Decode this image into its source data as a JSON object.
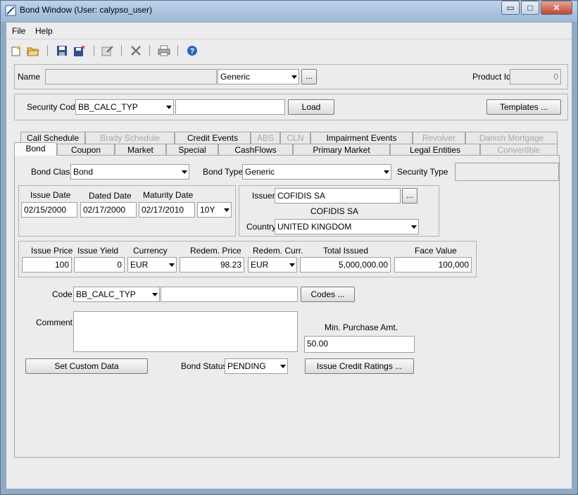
{
  "window": {
    "title": "Bond Window (User: calypso_user)",
    "controls": {
      "minimize": "▭",
      "maximize": "□",
      "close": "✕"
    }
  },
  "menu": {
    "file": "File",
    "help": "Help"
  },
  "toolbar": {
    "icons": [
      "new-icon",
      "open-icon",
      "save-icon",
      "save-as-icon",
      "edit-icon",
      "delete-icon",
      "print-icon",
      "help-icon"
    ]
  },
  "name_row": {
    "name_label": "Name",
    "name_value": "",
    "type_value": "Generic",
    "ellipsis": "...",
    "product_id_label": "Product Id",
    "product_id_value": "0"
  },
  "security_row": {
    "label": "Security Code",
    "code_value": "BB_CALC_TYP",
    "text_value": "",
    "load_button": "Load",
    "templates_button": "Templates ..."
  },
  "tabs_back": [
    {
      "label": "Call Schedule",
      "disabled": false
    },
    {
      "label": "Brady Schedule",
      "disabled": true
    },
    {
      "label": "Credit Events",
      "disabled": false
    },
    {
      "label": "ABS",
      "disabled": true
    },
    {
      "label": "CLN",
      "disabled": true
    },
    {
      "label": "Impairment Events",
      "disabled": false
    },
    {
      "label": "Revolver",
      "disabled": true
    },
    {
      "label": "Danish Mortgage",
      "disabled": true
    }
  ],
  "tabs_front": [
    {
      "label": "Bond",
      "active": true
    },
    {
      "label": "Coupon",
      "disabled": false
    },
    {
      "label": "Market",
      "disabled": false
    },
    {
      "label": "Special",
      "disabled": false
    },
    {
      "label": "CashFlows",
      "disabled": false
    },
    {
      "label": "Primary Market",
      "disabled": false
    },
    {
      "label": "Legal Entities",
      "disabled": false
    },
    {
      "label": "Convertible",
      "disabled": true
    }
  ],
  "bond": {
    "bond_class_label": "Bond Class",
    "bond_class_value": "Bond",
    "bond_type_label": "Bond Type",
    "bond_type_value": "Generic",
    "security_type_label": "Security Type",
    "security_type_value": "",
    "issue_date_label": "Issue Date",
    "issue_date_value": "02/15/2000",
    "dated_date_label": "Dated Date",
    "dated_date_value": "02/17/2000",
    "maturity_date_label": "Maturity Date",
    "maturity_date_value": "02/17/2010",
    "tenor_value": "10Y",
    "issuer_label": "Issuer",
    "issuer_value": "COFIDIS SA",
    "issuer_ellipsis": "...",
    "issuer_name": "COFIDIS SA",
    "country_label": "Country",
    "country_value": "UNITED KINGDOM",
    "issue_price_label": "Issue Price",
    "issue_price_value": "100",
    "issue_yield_label": "Issue Yield",
    "issue_yield_value": "0",
    "currency_label": "Currency",
    "currency_value": "EUR",
    "redem_price_label": "Redem. Price",
    "redem_price_value": "98.23",
    "redem_curr_label": "Redem. Curr.",
    "redem_curr_value": "EUR",
    "total_issued_label": "Total Issued",
    "total_issued_value": "5,000,000.00",
    "face_value_label": "Face Value",
    "face_value_value": "100,000",
    "code_label": "Code",
    "code_value": "BB_CALC_TYP",
    "code_text_value": "",
    "codes_button": "Codes ...",
    "comment_label": "Comment",
    "comment_value": "",
    "min_purchase_label": "Min. Purchase Amt.",
    "min_purchase_value": "50.00",
    "set_custom_button": "Set Custom Data",
    "bond_status_label": "Bond Status",
    "bond_status_value": "PENDING",
    "issue_credit_button": "Issue Credit Ratings ..."
  }
}
